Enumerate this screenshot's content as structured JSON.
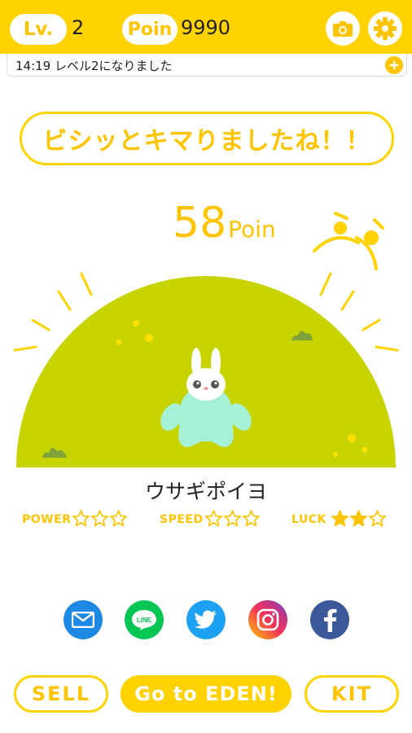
{
  "header": {
    "level_label": "Lv.",
    "level_value": "2",
    "points_label": "Poin",
    "points_value": "9990",
    "camera_icon": "camera-icon",
    "settings_icon": "gear-icon"
  },
  "news": {
    "text": "14:19 レベル2になりました",
    "plus_icon": "plus-icon"
  },
  "message": "ビシッとキマりましたね！！",
  "earned": {
    "value": "58",
    "unit": "Poin"
  },
  "character": {
    "name": "ウサギポイヨ"
  },
  "stats": [
    {
      "label": "POWER",
      "rating": 0,
      "max": 3
    },
    {
      "label": "SPEED",
      "rating": 0,
      "max": 3
    },
    {
      "label": "LUCK",
      "rating": 2,
      "max": 3
    }
  ],
  "share": [
    {
      "name": "mail",
      "icon": "mail-icon",
      "color": "#1E88E5"
    },
    {
      "name": "LINE",
      "icon": "line-icon",
      "color": "#06C755"
    },
    {
      "name": "twitter",
      "icon": "twitter-icon",
      "color": "#1DA1F2"
    },
    {
      "name": "instagram",
      "icon": "instagram-icon",
      "color": "#E1306C"
    },
    {
      "name": "facebook",
      "icon": "facebook-icon",
      "color": "#3B5998"
    }
  ],
  "actions": {
    "sell": "SELL",
    "eden": "Go to EDEN!",
    "kit": "KIT"
  },
  "colors": {
    "accent": "#FFD200",
    "accent_text": "#FFC400",
    "hill": "#C8D400",
    "character_body": "#A6F0D6"
  }
}
